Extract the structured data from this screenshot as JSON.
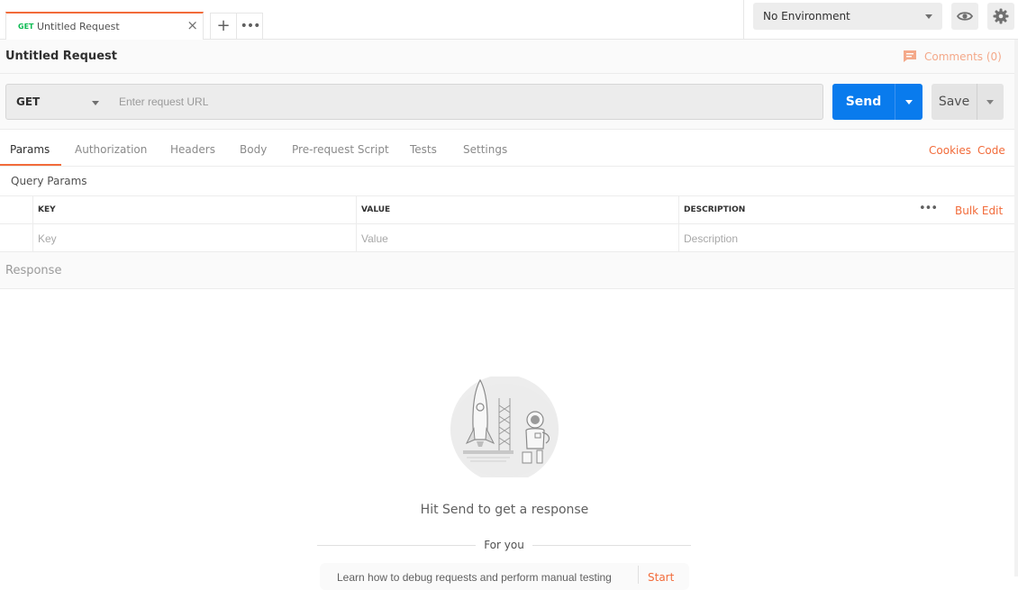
{
  "tabs": {
    "active": {
      "method": "GET",
      "name": "Untitled Request",
      "close": "×"
    },
    "new_tab": "+",
    "more": "•••"
  },
  "environment": {
    "selected": "No Environment"
  },
  "request": {
    "title": "Untitled Request",
    "comments": "Comments (0)",
    "method": "GET",
    "url_placeholder": "Enter request URL",
    "url_value": "",
    "send_label": "Send",
    "save_label": "Save"
  },
  "subtabs": {
    "items": [
      "Params",
      "Authorization",
      "Headers",
      "Body",
      "Pre-request Script",
      "Tests",
      "Settings"
    ],
    "active": "Params",
    "cookies": "Cookies",
    "code": "Code"
  },
  "params": {
    "section_label": "Query Params",
    "headers": {
      "key": "KEY",
      "value": "VALUE",
      "description": "DESCRIPTION"
    },
    "placeholders": {
      "key": "Key",
      "value": "Value",
      "description": "Description"
    },
    "more": "•••",
    "bulk_edit": "Bulk Edit"
  },
  "response": {
    "label": "Response",
    "empty_message": "Hit Send to get a response",
    "for_you": "For you",
    "tip": "Learn how to debug requests and perform manual testing",
    "tip_action": "Start"
  },
  "colors": {
    "accent": "#f26b3a",
    "send_blue": "#097bed",
    "get_green": "#0cbb52"
  },
  "icons": [
    "close-icon",
    "plus-icon",
    "more-icon",
    "caret-down-icon",
    "eye-icon",
    "gear-icon",
    "comment-icon",
    "rocket-astronaut-illustration"
  ]
}
